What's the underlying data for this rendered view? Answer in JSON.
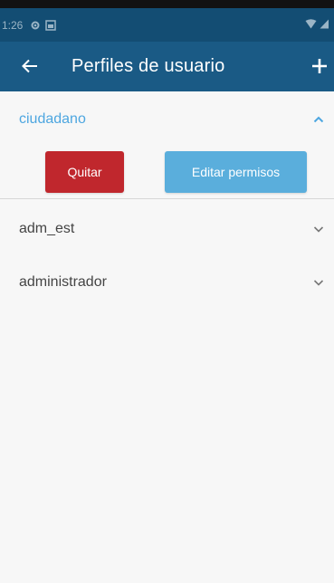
{
  "status_bar": {
    "time": "1:26",
    "icons": [
      "settings-icon",
      "screenshot-icon",
      "wifi-icon",
      "signal-icon"
    ]
  },
  "app_bar": {
    "title": "Perfiles de usuario",
    "back_icon": "arrow-left-icon",
    "add_icon": "plus-icon"
  },
  "profiles": [
    {
      "name": "ciudadano",
      "expanded": true,
      "chevron": "chevron-up-icon"
    },
    {
      "name": "adm_est",
      "expanded": false,
      "chevron": "chevron-down-icon"
    },
    {
      "name": "administrador",
      "expanded": false,
      "chevron": "chevron-down-icon"
    }
  ],
  "actions": {
    "remove_label": "Quitar",
    "edit_permissions_label": "Editar permisos"
  },
  "colors": {
    "status_bar": "#134d73",
    "app_bar": "#1a5a85",
    "accent": "#4da6e0",
    "remove_button": "#c0272d",
    "edit_button": "#5aaedc",
    "background": "#f7f7f7"
  }
}
